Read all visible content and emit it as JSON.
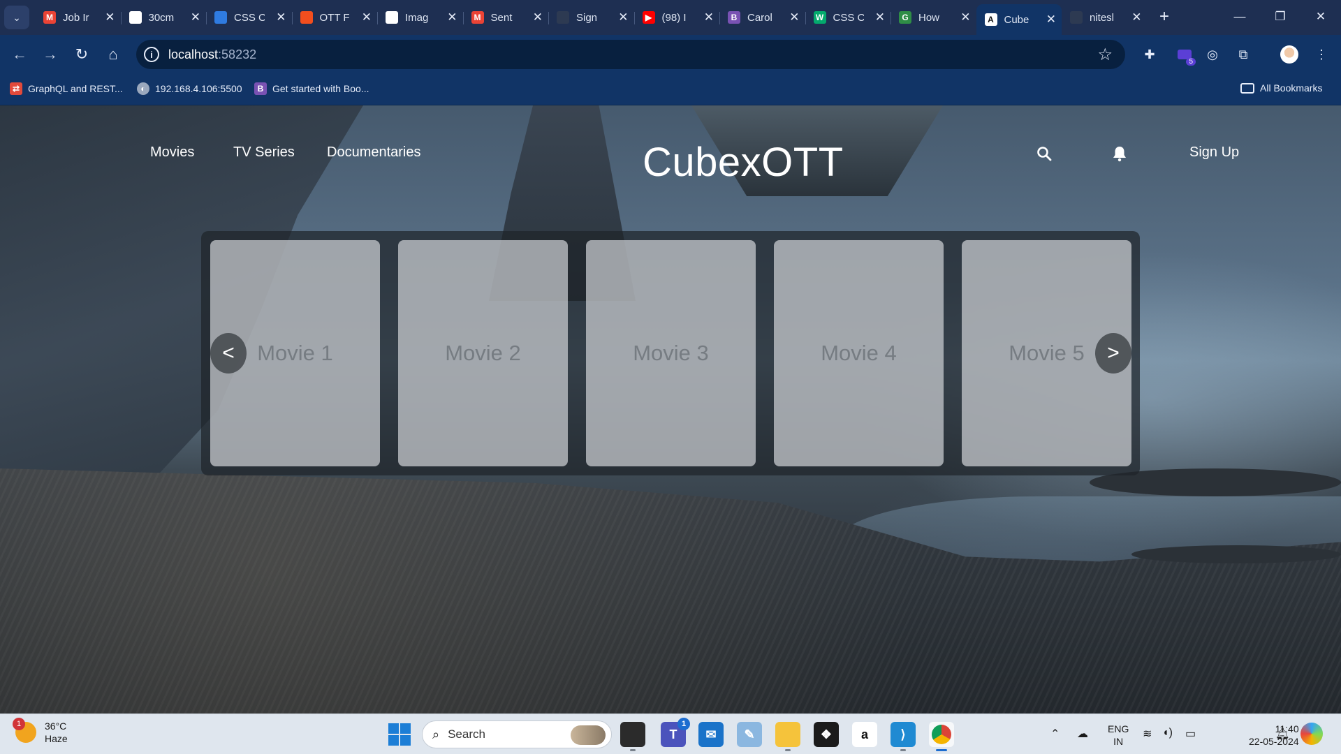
{
  "browser": {
    "tabs": [
      {
        "label": "Job Ir",
        "favicon": "gmail-icon",
        "color": "#ea4335",
        "glyph": "M"
      },
      {
        "label": "30cm",
        "favicon": "image-thumb-icon",
        "color": "#ffffff",
        "glyph": ""
      },
      {
        "label": "CSS C",
        "favicon": "edge-icon",
        "color": "#2f7be0",
        "glyph": ""
      },
      {
        "label": "OTT F",
        "favicon": "figma-icon",
        "color": "#f24e1e",
        "glyph": ""
      },
      {
        "label": "Imag",
        "favicon": "chatgpt-icon",
        "color": "#ffffff",
        "glyph": ""
      },
      {
        "label": "Sent",
        "favicon": "gmail-icon",
        "color": "#ea4335",
        "glyph": "M"
      },
      {
        "label": "Sign",
        "favicon": "github-icon",
        "color": "#2d3a52",
        "glyph": ""
      },
      {
        "label": "(98) I",
        "favicon": "youtube-icon",
        "color": "#ff0000",
        "glyph": "▶"
      },
      {
        "label": "Carol",
        "favicon": "bootstrap-icon",
        "color": "#7952b3",
        "glyph": "B"
      },
      {
        "label": "CSS C",
        "favicon": "w3schools-icon",
        "color": "#04aa6d",
        "glyph": "W"
      },
      {
        "label": "How",
        "favicon": "gfg-icon",
        "color": "#2f8d46",
        "glyph": "G"
      },
      {
        "label": "Cube",
        "favicon": "react-a-icon",
        "color": "#ffffff",
        "glyph": "A",
        "active": true
      },
      {
        "label": "nitesl",
        "favicon": "github-icon",
        "color": "#2d3a52",
        "glyph": ""
      }
    ],
    "address": {
      "host": "localhost",
      "port": ":58232"
    },
    "bookmarks": [
      {
        "label": "GraphQL and REST...",
        "icon": "graphql-icon",
        "color": "#e24a3b"
      },
      {
        "label": "192.168.4.106:5500",
        "icon": "globe-icon",
        "color": "#9aa8bd"
      },
      {
        "label": "Get started with Boo...",
        "icon": "bootstrap-icon",
        "color": "#7952b3"
      }
    ],
    "all_bookmarks": "All Bookmarks",
    "extension_badge": "5"
  },
  "site": {
    "nav": {
      "movies": "Movies",
      "tv_series": "TV Series",
      "documentaries": "Documentaries"
    },
    "brand": "CubexOTT",
    "sign_up": "Sign Up",
    "carousel": {
      "prev": "<",
      "next": ">",
      "cards": [
        "Movie 1",
        "Movie 2",
        "Movie 3",
        "Movie 4",
        "Movie 5"
      ]
    }
  },
  "taskbar": {
    "weather": {
      "temp": "36°C",
      "condition": "Haze",
      "badge": "1"
    },
    "search_label": "Search",
    "teams_badge": "1",
    "lang": {
      "line1": "ENG",
      "line2": "IN"
    },
    "clock": {
      "time": "11:40",
      "date": "22-05-2024"
    }
  }
}
